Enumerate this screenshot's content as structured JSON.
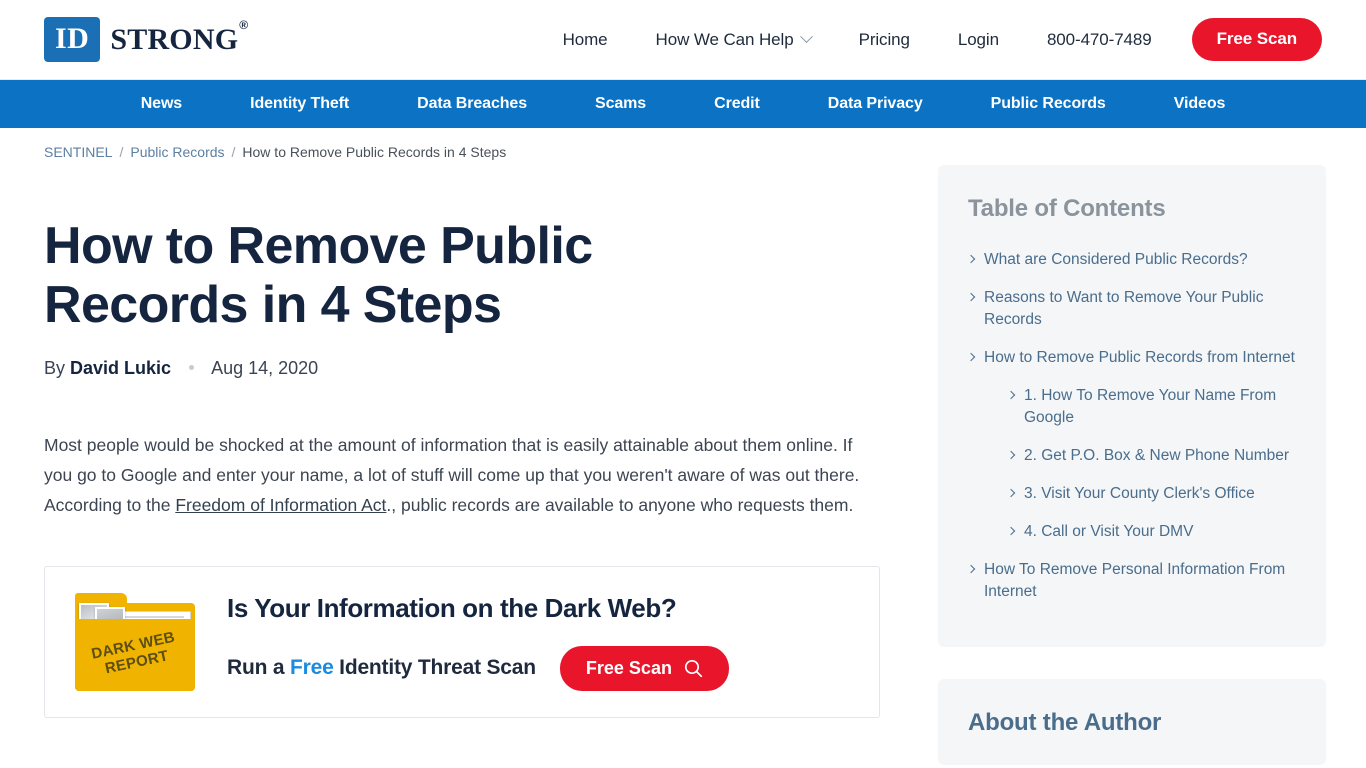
{
  "brand": {
    "logo_badge": "ID",
    "logo_word": "STRONG",
    "logo_reg": "®",
    "accent_red": "#e8152b",
    "accent_blue": "#0b72c4",
    "navy": "#16253f"
  },
  "header": {
    "nav": [
      {
        "label": "Home",
        "icon": null
      },
      {
        "label": "How We Can Help",
        "icon": "chevron-down-icon"
      },
      {
        "label": "Pricing",
        "icon": null
      },
      {
        "label": "Login",
        "icon": null
      },
      {
        "label": "800-470-7489",
        "icon": null
      }
    ],
    "cta_label": "Free Scan"
  },
  "blue_nav": {
    "items": [
      "News",
      "Identity Theft",
      "Data Breaches",
      "Scams",
      "Credit",
      "Data Privacy",
      "Public Records",
      "Videos"
    ]
  },
  "breadcrumb": {
    "root": "SENTINEL",
    "section": "Public Records",
    "current": "How to Remove Public Records in 4 Steps",
    "separator": "/"
  },
  "article": {
    "title": "How to Remove Public Records in 4 Steps",
    "by_prefix": "By",
    "author": "David Lukic",
    "date": "Aug 14, 2020",
    "paragraph_part1": "Most people would be shocked at the amount of information that is easily attainable about them online. If you go to Google and enter your name, a lot of stuff will come up that you weren't aware of was out there. According to the ",
    "paragraph_link": "Freedom of Information Act",
    "paragraph_part2": "., public records are available to anyone who requests them."
  },
  "dark_web_banner": {
    "folder_label_line1": "DARK WEB",
    "folder_label_line2": "REPORT",
    "heading": "Is Your Information on the Dark Web?",
    "sub_pre": "Run a ",
    "sub_free": "Free",
    "sub_post": " Identity Threat Scan",
    "cta_label": "Free Scan",
    "cta_icon": "search-icon",
    "folder_color": "#f0b400"
  },
  "sidebar": {
    "toc_title": "Table of Contents",
    "toc": [
      {
        "label": "What are Considered Public Records?",
        "children": []
      },
      {
        "label": "Reasons to Want to Remove Your Public Records",
        "children": []
      },
      {
        "label": "How to Remove Public Records from Internet",
        "children": [
          "1. How To Remove Your Name From Google",
          "2. Get P.O. Box & New Phone Number",
          "3. Visit Your County Clerk's Office",
          "4. Call or Visit Your DMV"
        ]
      },
      {
        "label": "How To Remove Personal Information From Internet",
        "children": []
      }
    ],
    "author_card_title": "About the Author"
  }
}
